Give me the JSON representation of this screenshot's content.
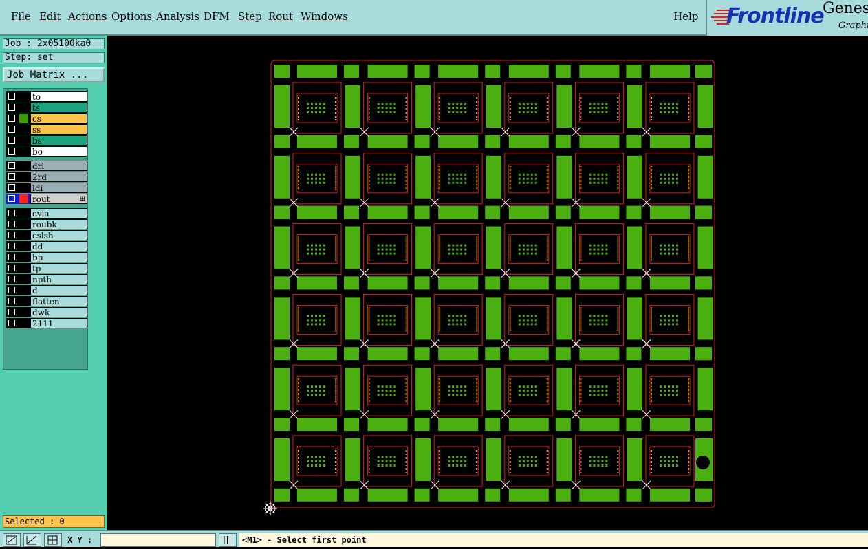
{
  "menu": {
    "items": [
      {
        "label": "File",
        "x_name": "file"
      },
      {
        "label": "Edit",
        "x_name": "edit"
      },
      {
        "label": "Actions",
        "x_name": "actions"
      },
      {
        "label": "Options",
        "x_name": "options"
      },
      {
        "label": "Analysis",
        "x_name": "analysis"
      },
      {
        "label": "DFM",
        "x_name": "dfm"
      },
      {
        "label": "Step",
        "x_name": "step"
      },
      {
        "label": "Rout",
        "x_name": "rout"
      },
      {
        "label": "Windows",
        "x_name": "windows"
      }
    ],
    "help": "Help"
  },
  "logo": {
    "brand": "Frontline",
    "product": "Genes",
    "sub": "Graphi",
    "brand_color": "#1a2fb4",
    "accent_color": "#e02020"
  },
  "job": {
    "job_line": "Job : 2x05100ka0",
    "step_line": "Step: set",
    "matrix_button": "Job Matrix ..."
  },
  "layers": [
    {
      "name": "to",
      "color": "#000000",
      "bg": "#ffffff"
    },
    {
      "name": "ts",
      "color": "#000000",
      "bg": "#19a37e"
    },
    {
      "name": "cs",
      "color": "#3c9a00",
      "bg": "#ffc24a"
    },
    {
      "name": "ss",
      "color": "#000000",
      "bg": "#ffc24a"
    },
    {
      "name": "bs",
      "color": "#000000",
      "bg": "#19a37e"
    },
    {
      "name": "bo",
      "color": "#000000",
      "bg": "#ffffff"
    },
    {
      "name": "drl",
      "color": "#000000",
      "bg": "#9ab0b8"
    },
    {
      "name": "2rd",
      "color": "#000000",
      "bg": "#9ab0b8"
    },
    {
      "name": "ldi",
      "color": "#000000",
      "bg": "#9ab0b8"
    },
    {
      "name": "rout",
      "color": "#ff2020",
      "bg": "#d0d0d0",
      "active": true
    },
    {
      "name": "cvia",
      "color": "#000000",
      "bg": "#a8dcdc"
    },
    {
      "name": "roubk",
      "color": "#000000",
      "bg": "#a8dcdc"
    },
    {
      "name": "cslsh",
      "color": "#000000",
      "bg": "#a8dcdc"
    },
    {
      "name": "dd",
      "color": "#000000",
      "bg": "#a8dcdc"
    },
    {
      "name": "bp",
      "color": "#000000",
      "bg": "#a8dcdc"
    },
    {
      "name": "tp",
      "color": "#000000",
      "bg": "#a8dcdc"
    },
    {
      "name": "npth",
      "color": "#000000",
      "bg": "#a8dcdc"
    },
    {
      "name": "d",
      "color": "#000000",
      "bg": "#a8dcdc"
    },
    {
      "name": "flatten",
      "color": "#000000",
      "bg": "#a8dcdc"
    },
    {
      "name": "dwk",
      "color": "#000000",
      "bg": "#a8dcdc"
    },
    {
      "name": "2111",
      "color": "#000000",
      "bg": "#a8dcdc"
    }
  ],
  "selected": "Selected : 0",
  "status": {
    "xy_label": "X Y :",
    "xy_value": "",
    "prompt": "<M1> - Select first point"
  },
  "board": {
    "rows": 6,
    "cols": 6,
    "pad_color": "#4caf10",
    "outline_color": "#e01818",
    "cross_color": "#ffffff"
  }
}
